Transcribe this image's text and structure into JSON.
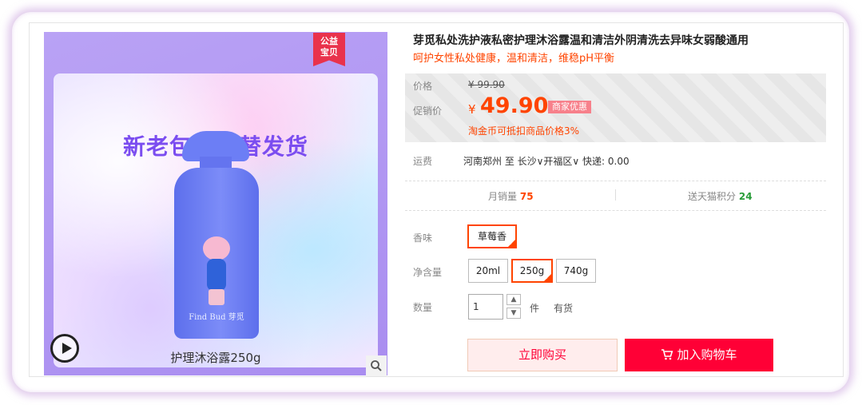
{
  "product": {
    "badge": "公益\n宝贝",
    "promo_banner": "新老包装交替发货",
    "brand_on_bottle": "Find Bud 芽觅",
    "caption": "护理沐浴露250g",
    "title": "芽觅私处洗护液私密护理沐浴露温和清洁外阴清洗去异味女弱酸通用",
    "subtitle": "呵护女性私处健康，温和清洁，维稳pH平衡"
  },
  "price": {
    "price_label": "价格",
    "old_price": "¥ 99.90",
    "promo_label": "促销价",
    "currency": "¥",
    "promo_price": "49.90",
    "shop_tag": "商家优惠",
    "coin_note": "淘金币可抵扣商品价格3%"
  },
  "shipping": {
    "label": "运费",
    "value": "河南郑州 至 长沙∨开福区∨ 快递: 0.00"
  },
  "stats": {
    "monthly_sales_label": "月销量",
    "monthly_sales": "75",
    "points_label": "送天猫积分",
    "points": "24"
  },
  "options": {
    "scent_label": "香味",
    "scent_values": [
      "草莓香"
    ],
    "volume_label": "净含量",
    "volume_values": [
      "20ml",
      "250g",
      "740g"
    ],
    "selected_volume": "250g"
  },
  "quantity": {
    "label": "数量",
    "value": "1",
    "unit": "件",
    "stock": "有货"
  },
  "actions": {
    "buy_now": "立即购买",
    "add_cart": "加入购物车"
  },
  "colors": {
    "accent": "#ff0036",
    "price": "#ff4400",
    "panel": "#a98df0"
  }
}
